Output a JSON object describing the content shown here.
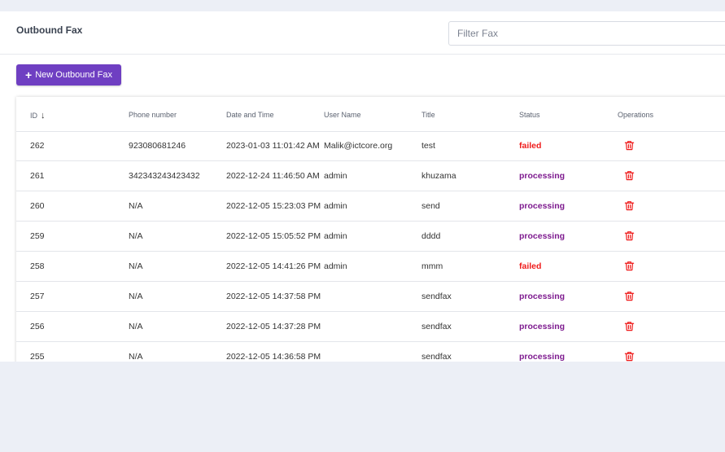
{
  "page": {
    "title": "Outbound Fax"
  },
  "filter": {
    "placeholder": "Filter Fax",
    "value": ""
  },
  "new_button": {
    "label": "New Outbound Fax",
    "icon": "plus-icon"
  },
  "colors": {
    "accent": "#6f3fc2",
    "failed": "#ef1b1b",
    "processing": "#7e1b8f",
    "background": "#eceff6"
  },
  "table": {
    "columns": [
      {
        "label": "ID",
        "sort": "descending",
        "sort_icon": "arrow-down-icon"
      },
      {
        "label": "Phone number"
      },
      {
        "label": "Date and Time"
      },
      {
        "label": "User Name"
      },
      {
        "label": "Title"
      },
      {
        "label": "Status"
      },
      {
        "label": "Operations"
      }
    ],
    "rows": [
      {
        "id": "262",
        "phone": "923080681246",
        "datetime": "2023-01-03 11:01:42 AM",
        "user": "Malik@ictcore.org",
        "title": "test",
        "status": "failed",
        "operation_icon": "trash-icon"
      },
      {
        "id": "261",
        "phone": "342343243423432",
        "datetime": "2022-12-24 11:46:50 AM",
        "user": "admin",
        "title": "khuzama",
        "status": "processing",
        "operation_icon": "trash-icon"
      },
      {
        "id": "260",
        "phone": "N/A",
        "datetime": "2022-12-05 15:23:03 PM",
        "user": "admin",
        "title": "send",
        "status": "processing",
        "operation_icon": "trash-icon"
      },
      {
        "id": "259",
        "phone": "N/A",
        "datetime": "2022-12-05 15:05:52 PM",
        "user": "admin",
        "title": "dddd",
        "status": "processing",
        "operation_icon": "trash-icon"
      },
      {
        "id": "258",
        "phone": "N/A",
        "datetime": "2022-12-05 14:41:26 PM",
        "user": "admin",
        "title": "mmm",
        "status": "failed",
        "operation_icon": "trash-icon"
      },
      {
        "id": "257",
        "phone": "N/A",
        "datetime": "2022-12-05 14:37:58 PM",
        "user": "",
        "title": "sendfax",
        "status": "processing",
        "operation_icon": "trash-icon"
      },
      {
        "id": "256",
        "phone": "N/A",
        "datetime": "2022-12-05 14:37:28 PM",
        "user": "",
        "title": "sendfax",
        "status": "processing",
        "operation_icon": "trash-icon"
      },
      {
        "id": "255",
        "phone": "N/A",
        "datetime": "2022-12-05 14:36:58 PM",
        "user": "",
        "title": "sendfax",
        "status": "processing",
        "operation_icon": "trash-icon"
      }
    ]
  }
}
